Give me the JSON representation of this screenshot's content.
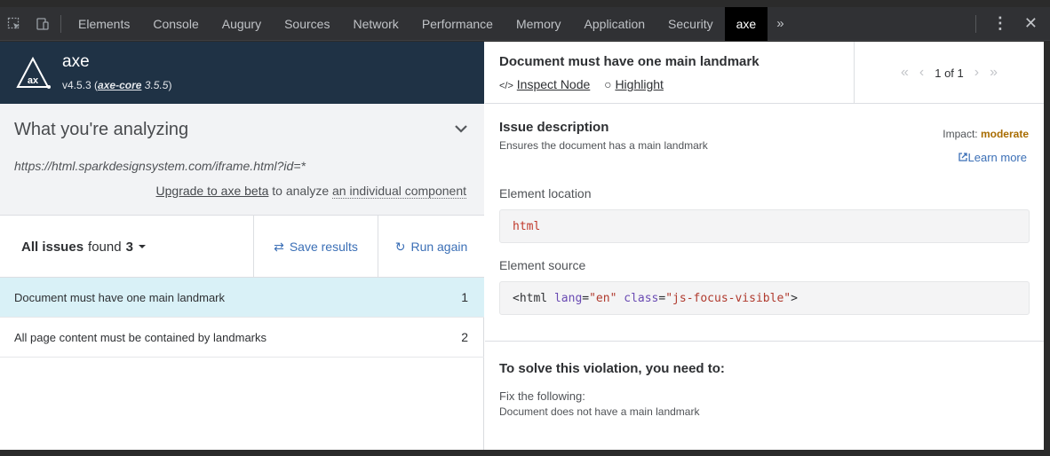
{
  "devtools": {
    "tabs": [
      "Elements",
      "Console",
      "Augury",
      "Sources",
      "Network",
      "Performance",
      "Memory",
      "Application",
      "Security",
      "axe"
    ],
    "more": "»",
    "kebab": "⋮",
    "close": "✕"
  },
  "brand": {
    "name": "axe",
    "version": "v4.5.3",
    "core_link": "axe-core",
    "core_version": "3.5.5"
  },
  "analyze": {
    "title": "What you're analyzing",
    "url": "https://html.sparkdesignsystem.com/iframe.html?id=*",
    "upgrade_link": "Upgrade to axe beta",
    "upgrade_mid": " to analyze ",
    "upgrade_component": "an individual component"
  },
  "issues": {
    "label": "All issues",
    "found": "found",
    "count": "3",
    "save_label": "Save results",
    "run_label": "Run again",
    "rows": [
      {
        "title": "Document must have one main landmark",
        "count": "1"
      },
      {
        "title": "All page content must be contained by landmarks",
        "count": "2"
      }
    ]
  },
  "detail": {
    "title": "Document must have one main landmark",
    "inspect_label": "Inspect Node",
    "highlight_label": "Highlight",
    "pager": "1 of 1",
    "desc_title": "Issue description",
    "desc_text": "Ensures the document has a main landmark",
    "impact_label": "Impact:",
    "impact_value": "moderate",
    "learn_more": "Learn more",
    "location_label": "Element location",
    "location_value": "html",
    "source_label": "Element source",
    "source_tag_open": "<html",
    "source_attr1": "lang",
    "source_val1": "\"en\"",
    "source_attr2": "class",
    "source_val2": "\"js-focus-visible\"",
    "source_tag_close": ">",
    "solve_title": "To solve this violation, you need to:",
    "fix_label": "Fix the following:",
    "fix_message": "Document does not have a main landmark"
  },
  "colors": {
    "brand_bg": "#1f3245",
    "selected_row": "#d9f1f7",
    "link_blue": "#3b6fb6",
    "impact_moderate": "#a86c00"
  }
}
